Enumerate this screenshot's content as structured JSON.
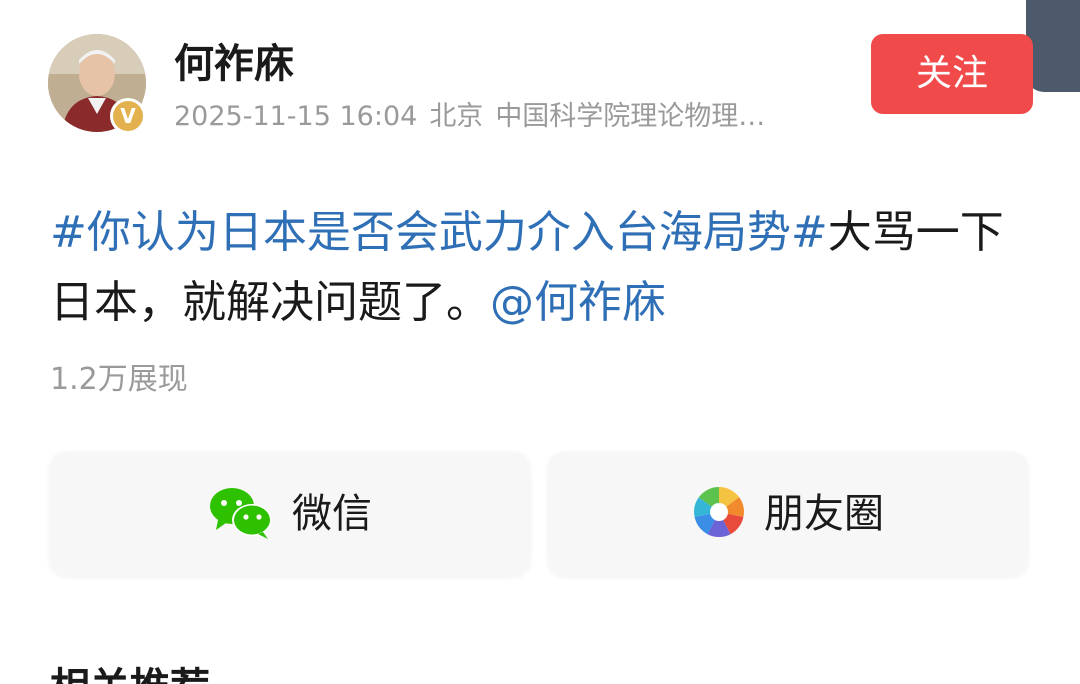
{
  "header": {
    "author_name": "何祚庥",
    "verified_badge": "V",
    "timestamp": "2025-11-15 16:04",
    "location": "北京",
    "description": "中国科学院理论物理…",
    "follow_label": "关注"
  },
  "post": {
    "topic": "#你认为日本是否会武力介入台海局势#",
    "text": "大骂一下日本，就解决问题了。",
    "mention": "@何祚庥",
    "views": "1.2万展现"
  },
  "share": {
    "wechat_label": "微信",
    "moments_label": "朋友圈"
  },
  "section": {
    "heading": "相关推荐"
  },
  "colors": {
    "accent_red": "#f04a4a",
    "link_blue": "#2f6fb6",
    "muted_gray": "#9a9a9a",
    "wechat_green": "#2dc100",
    "badge_gold": "#e3b24e"
  },
  "icons": {
    "wechat": "wechat-icon",
    "moments": "moments-icon"
  }
}
